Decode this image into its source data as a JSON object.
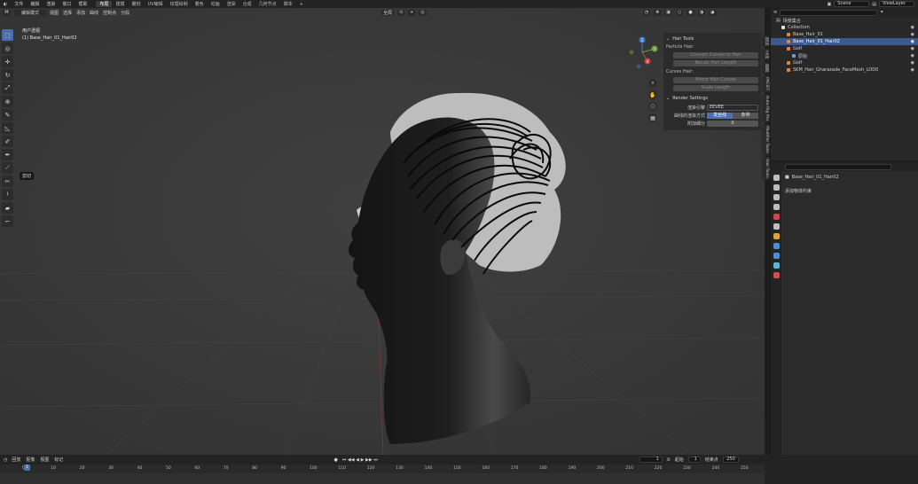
{
  "topbar": {
    "menus": [
      "文件",
      "编辑",
      "渲染",
      "窗口",
      "帮助"
    ],
    "workspaces": [
      {
        "label": "布局",
        "active": true
      },
      {
        "label": "建模",
        "active": false
      },
      {
        "label": "雕刻",
        "active": false
      },
      {
        "label": "UV编辑",
        "active": false
      },
      {
        "label": "纹理绘制",
        "active": false
      },
      {
        "label": "着色",
        "active": false
      },
      {
        "label": "动画",
        "active": false
      },
      {
        "label": "渲染",
        "active": false
      },
      {
        "label": "合成",
        "active": false
      },
      {
        "label": "几何节点",
        "active": false
      },
      {
        "label": "脚本",
        "active": false
      }
    ],
    "add_workspace": "+",
    "scene": "Scene",
    "view_layer": "ViewLayer"
  },
  "viewport": {
    "mode": "编辑模式",
    "menus": [
      "视图",
      "选择",
      "添加",
      "曲线",
      "控制点",
      "分段"
    ],
    "transform": "全局",
    "info_line1": "用户透视",
    "info_line2": "(1) Base_Hair_01_Hair02",
    "tooltip": "剪切",
    "tools": [
      {
        "icon": "select-box-icon",
        "glyph": "⬚",
        "active": true
      },
      {
        "icon": "cursor-icon",
        "glyph": "◎",
        "active": false
      },
      {
        "icon": "move-icon",
        "glyph": "✛",
        "active": false
      },
      {
        "icon": "rotate-icon",
        "glyph": "↻",
        "active": false
      },
      {
        "icon": "scale-icon",
        "glyph": "⤢",
        "active": false
      },
      {
        "icon": "transform-icon",
        "glyph": "⊕",
        "active": false
      },
      {
        "icon": "annotate-icon",
        "glyph": "✎",
        "active": false
      },
      {
        "icon": "measure-icon",
        "glyph": "◺",
        "active": false
      },
      {
        "icon": "draw-icon",
        "glyph": "✐",
        "active": false
      },
      {
        "icon": "pen-icon",
        "glyph": "✒",
        "active": false
      },
      {
        "icon": "extrude-icon",
        "glyph": "⟋",
        "active": false
      },
      {
        "icon": "cut-icon",
        "glyph": "✂",
        "active": false
      },
      {
        "icon": "tilt-icon",
        "glyph": "⟊",
        "active": false
      },
      {
        "icon": "randomize-icon",
        "glyph": "▰",
        "active": false
      },
      {
        "icon": "radius-icon",
        "glyph": "⌐",
        "active": false
      }
    ],
    "gizmo": {
      "x": "X",
      "y": "Y",
      "z": "Z"
    }
  },
  "npanel": {
    "hair_tools": {
      "title": "Hair Tools",
      "particle_section": "Particle Hair:",
      "btn_convert": "Convert Curves to Hair",
      "btn_recalc": "Recalc Hair Length",
      "curves_section": "Curves Hair:",
      "btn_mirror": "Mirror Hair Curves",
      "btn_scale": "Scale Length"
    },
    "render_settings": {
      "title": "Render Settings",
      "engine_label": "渲染引擎",
      "engine_value": "EEVEE",
      "hair_mode_label": "曲线的渲染方式",
      "hair_mode_options": [
        {
          "label": "发丝线",
          "on": true
        },
        {
          "label": "条带",
          "on": false
        }
      ],
      "subdiv_label": "附加细分",
      "subdiv_value": "0"
    },
    "tabs": [
      "项目",
      "工具",
      "视图",
      "FACEIT",
      "Auto-Rig Pro",
      "Modifier Tools",
      "Hair Tools"
    ]
  },
  "outliner": {
    "title": "场景集合",
    "rows": [
      {
        "label": "Collection",
        "indent": 1,
        "color": "#e0e0e0",
        "selected": false
      },
      {
        "label": "Base_Hair_01",
        "indent": 2,
        "color": "#e8843a",
        "selected": false
      },
      {
        "label": "Base_Hair_01_Hair02",
        "indent": 2,
        "color": "#e8843a",
        "selected": true
      },
      {
        "label": "Golf",
        "indent": 2,
        "color": "#e8843a",
        "selected": false
      },
      {
        "label": "原始",
        "indent": 3,
        "color": "#6aa0d8",
        "selected": false
      },
      {
        "label": "Golf",
        "indent": 2,
        "color": "#e8843a",
        "selected": false
      },
      {
        "label": "SKM_Hair_Gharazade_FaceMesh_LOD0",
        "indent": 2,
        "color": "#e8843a",
        "selected": false
      }
    ]
  },
  "properties": {
    "search_placeholder": "",
    "object_name": "Base_Hair_01_Hair02",
    "add_modifier": "添加物体约束",
    "icon_colors": [
      "#bdbdbd",
      "#bdbdbd",
      "#bdbdbd",
      "#bdbdbd",
      "#d04848",
      "#bdbdbd",
      "#e0a040",
      "#4a8fd6",
      "#4a8fd6",
      "#5fb8d0",
      "#d05050"
    ]
  },
  "timeline": {
    "menus": [
      "回放",
      "抠像",
      "视图",
      "标记"
    ],
    "current_frame": "1",
    "start_label": "起始",
    "start_value": "1",
    "end_label": "结束点",
    "end_value": "250",
    "ticks": [
      "0",
      "10",
      "20",
      "30",
      "40",
      "50",
      "60",
      "70",
      "80",
      "90",
      "100",
      "110",
      "120",
      "130",
      "140",
      "150",
      "160",
      "170",
      "180",
      "190",
      "200",
      "210",
      "220",
      "230",
      "240",
      "250"
    ],
    "playhead": "1"
  },
  "colors": {
    "accent": "#4c72b0",
    "hair": "#0a0a0a",
    "shell": "#bdbdbd"
  }
}
